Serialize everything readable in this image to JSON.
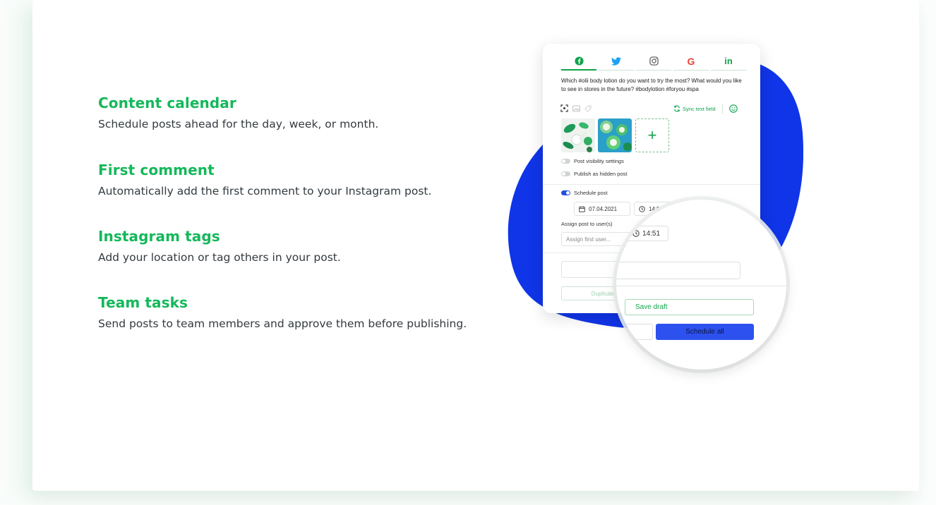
{
  "features": [
    {
      "title": "Content calendar",
      "description": "Schedule posts ahead for the day, week, or month."
    },
    {
      "title": "First comment",
      "description": "Automatically add the first comment to your Instagram post."
    },
    {
      "title": "Instagram tags",
      "description": "Add your location or tag others in your post."
    },
    {
      "title": "Team tasks",
      "description": "Send posts to team members and approve them before publishing."
    }
  ],
  "composer": {
    "tabs": [
      {
        "icon": "facebook-icon",
        "label": "",
        "color": "#10a34a",
        "active": true
      },
      {
        "icon": "twitter-icon",
        "label": "",
        "color": "#1da1f2",
        "active": false
      },
      {
        "icon": "instagram-icon",
        "label": "",
        "color": "#555555",
        "active": false
      },
      {
        "icon": "google-icon",
        "label": "G",
        "color": "#ea4335",
        "active": false
      },
      {
        "icon": "linkedin-icon",
        "label": "in",
        "color": "#10a34a",
        "active": false
      }
    ],
    "post_text": "Which #olii body lotion do you want to try the most? What would you like to see in stores in the future? #bodylotion #foryou #spa",
    "sync_label": "Sync text field",
    "add_media_symbol": "+",
    "post_visibility_label": "Post visibility settings",
    "hidden_post_label": "Publish as hidden post",
    "schedule_post_label": "Schedule post",
    "schedule_date": "07.04.2021",
    "schedule_time_partial": "14:5",
    "assign_label": "Assign post to user(s)",
    "assign_placeholder": "Assign first user...",
    "duplicate_label": "Duplicate po"
  },
  "magnifier": {
    "time": "14:51",
    "save_draft_label": "Save draft",
    "schedule_all_label": "Schedule all"
  },
  "colors": {
    "accent_green": "#14b85a",
    "blob_blue": "#1035e8",
    "schedule_button": "#2d51ef"
  }
}
